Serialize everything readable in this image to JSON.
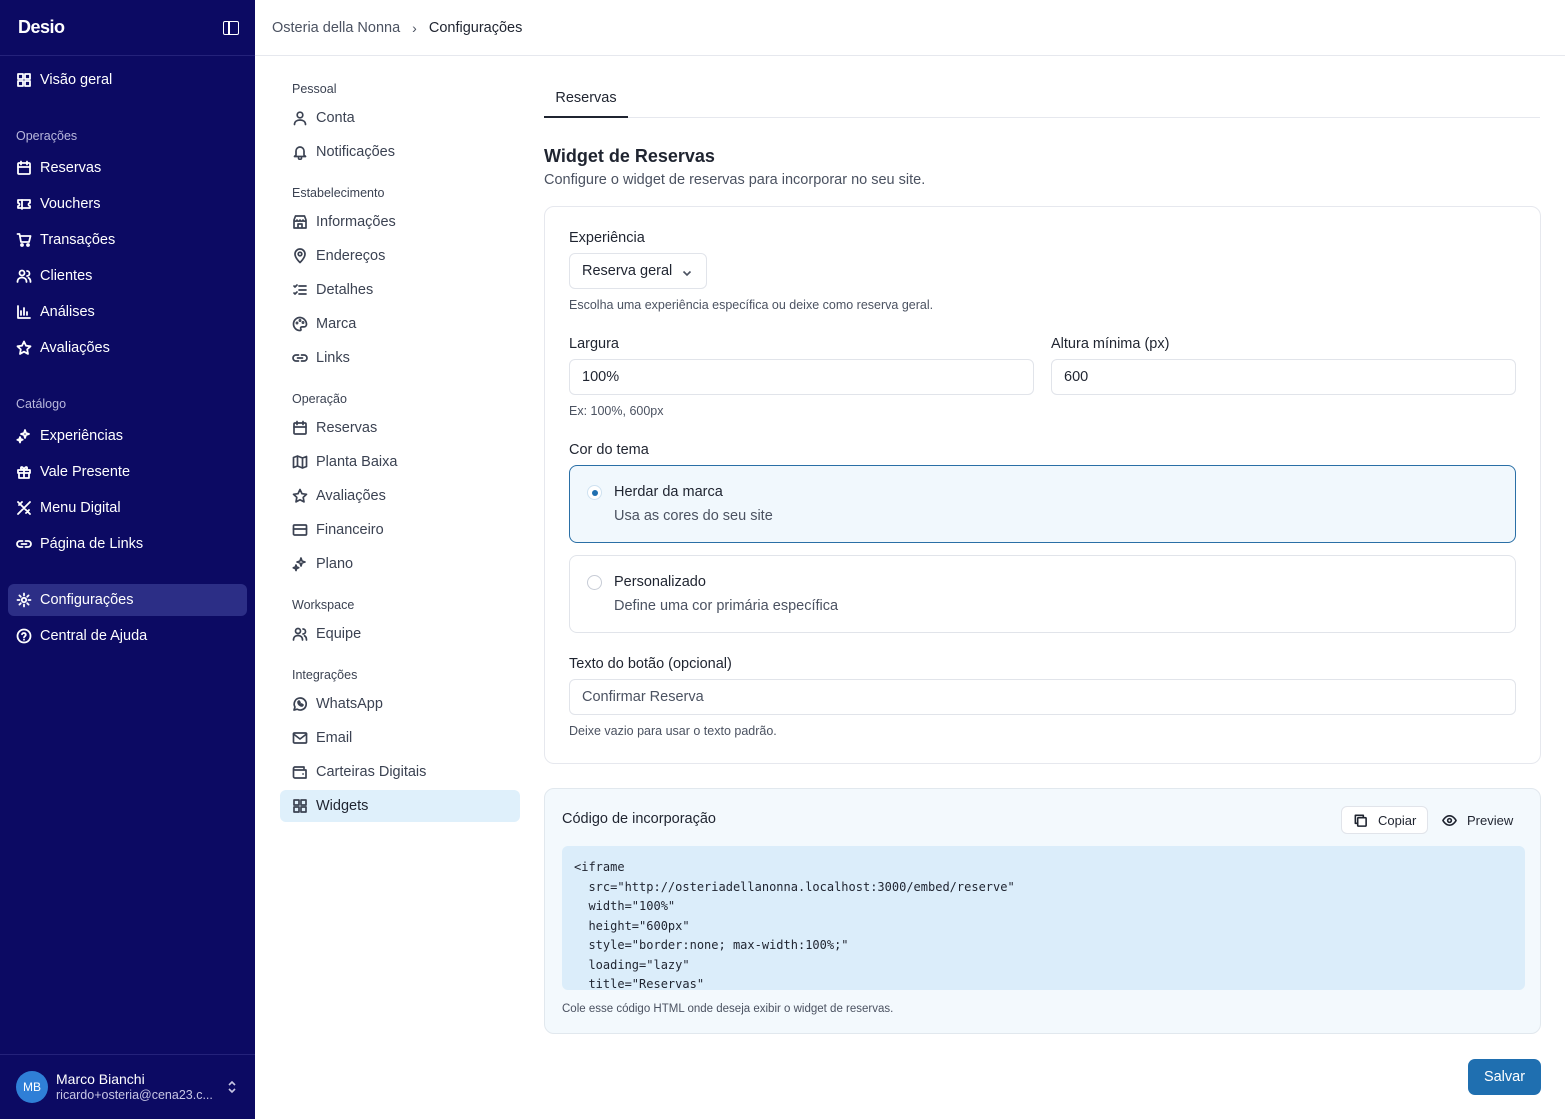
{
  "app": {
    "logo": "Desio"
  },
  "breadcrumb": {
    "parent": "Osteria della Nonna",
    "sep": "›",
    "current": "Configurações"
  },
  "sidebar": {
    "overview": "Visão geral",
    "sections": [
      {
        "label": "Operações",
        "items": [
          "Reservas",
          "Vouchers",
          "Transações",
          "Clientes",
          "Análises",
          "Avaliações"
        ]
      },
      {
        "label": "Catálogo",
        "items": [
          "Experiências",
          "Vale Presente",
          "Menu Digital",
          "Página de Links"
        ]
      }
    ],
    "settings": "Configurações",
    "help": "Central de Ajuda",
    "user": {
      "initials": "MB",
      "name": "Marco Bianchi",
      "email": "ricardo+osteria@cena23.c..."
    }
  },
  "settings_nav": {
    "groups": [
      {
        "label": "Pessoal",
        "items": [
          "Conta",
          "Notificações"
        ]
      },
      {
        "label": "Estabelecimento",
        "items": [
          "Informações",
          "Endereços",
          "Detalhes",
          "Marca",
          "Links"
        ]
      },
      {
        "label": "Operação",
        "items": [
          "Reservas",
          "Planta Baixa",
          "Avaliações",
          "Financeiro",
          "Plano"
        ]
      },
      {
        "label": "Workspace",
        "items": [
          "Equipe"
        ]
      },
      {
        "label": "Integrações",
        "items": [
          "WhatsApp",
          "Email",
          "Carteiras Digitais",
          "Widgets"
        ]
      }
    ]
  },
  "main": {
    "tab": "Reservas",
    "title": "Widget de Reservas",
    "subtitle": "Configure o widget de reservas para incorporar no seu site.",
    "experience": {
      "label": "Experiência",
      "value": "Reserva geral",
      "help": "Escolha uma experiência específica ou deixe como reserva geral."
    },
    "width": {
      "label": "Largura",
      "value": "100%",
      "help": "Ex: 100%, 600px"
    },
    "min_height": {
      "label": "Altura mínima (px)",
      "value": "600"
    },
    "theme": {
      "label": "Cor do tema",
      "options": [
        {
          "title": "Herdar da marca",
          "desc": "Usa as cores do seu site",
          "selected": true
        },
        {
          "title": "Personalizado",
          "desc": "Define uma cor primária específica",
          "selected": false
        }
      ]
    },
    "button_text": {
      "label": "Texto do botão (opcional)",
      "placeholder": "Confirmar Reserva",
      "help": "Deixe vazio para usar o texto padrão."
    },
    "embed": {
      "title": "Código de incorporação",
      "copy": "Copiar",
      "preview": "Preview",
      "code": "<iframe\n  src=\"http://osteriadellanonna.localhost:3000/embed/reserve\"\n  width=\"100%\"\n  height=\"600px\"\n  style=\"border:none; max-width:100%;\"\n  loading=\"lazy\"\n  title=\"Reservas\"",
      "help": "Cole esse código HTML onde deseja exibir o widget de reservas."
    },
    "save": "Salvar"
  },
  "colors": {
    "sidebar_bg": "#0c0a63",
    "primary": "#1f6fb0",
    "active_sub": "#dff0fb"
  }
}
